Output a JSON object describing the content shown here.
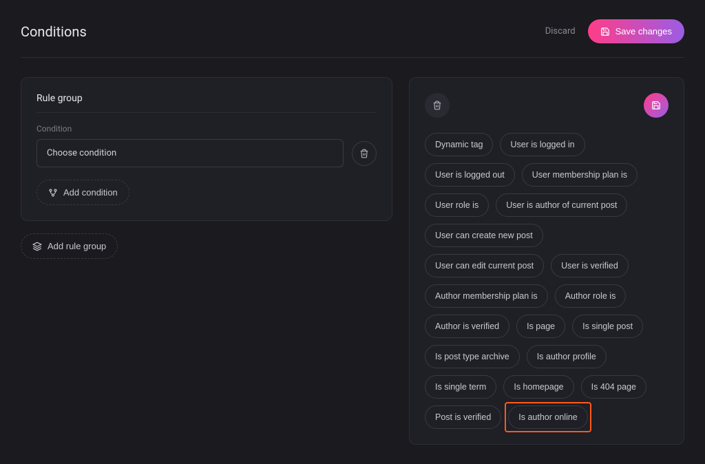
{
  "header": {
    "title": "Conditions",
    "discard_label": "Discard",
    "save_label": "Save changes"
  },
  "rule_group": {
    "title": "Rule group",
    "condition_label": "Condition",
    "choose_placeholder": "Choose condition",
    "add_condition_label": "Add condition"
  },
  "add_rule_group_label": "Add rule group",
  "condition_options": [
    {
      "label": "Dynamic tag",
      "highlight": false
    },
    {
      "label": "User is logged in",
      "highlight": false
    },
    {
      "label": "User is logged out",
      "highlight": false
    },
    {
      "label": "User membership plan is",
      "highlight": false
    },
    {
      "label": "User role is",
      "highlight": false
    },
    {
      "label": "User is author of current post",
      "highlight": false
    },
    {
      "label": "User can create new post",
      "highlight": false
    },
    {
      "label": "User can edit current post",
      "highlight": false
    },
    {
      "label": "User is verified",
      "highlight": false
    },
    {
      "label": "Author membership plan is",
      "highlight": false
    },
    {
      "label": "Author role is",
      "highlight": false
    },
    {
      "label": "Author is verified",
      "highlight": false
    },
    {
      "label": "Is page",
      "highlight": false
    },
    {
      "label": "Is single post",
      "highlight": false
    },
    {
      "label": "Is post type archive",
      "highlight": false
    },
    {
      "label": "Is author profile",
      "highlight": false
    },
    {
      "label": "Is single term",
      "highlight": false
    },
    {
      "label": "Is homepage",
      "highlight": false
    },
    {
      "label": "Is 404 page",
      "highlight": false
    },
    {
      "label": "Post is verified",
      "highlight": false
    },
    {
      "label": "Is author online",
      "highlight": true
    }
  ]
}
